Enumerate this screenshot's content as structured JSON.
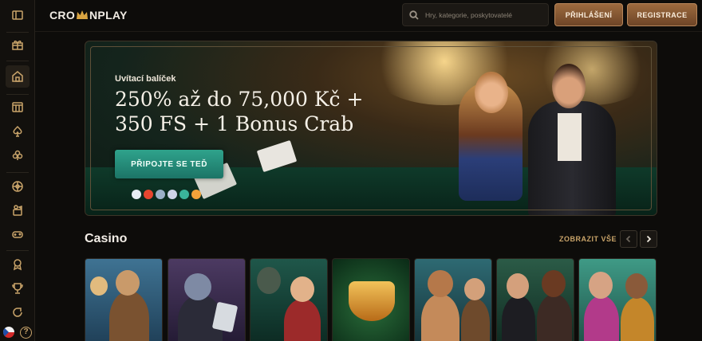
{
  "header": {
    "logo_text_left": "CRO",
    "logo_text_right": "NPLAY",
    "search_placeholder": "Hry, kategorie, poskytovatelé",
    "login_label": "PŘIHLÁŠENÍ",
    "register_label": "REGISTRACE"
  },
  "sidebar": {
    "icons": [
      "panel-toggle-icon",
      "gift-icon",
      "home-icon",
      "slot-machine-icon",
      "spade-icon",
      "clover-icon",
      "roulette-icon",
      "live-dealer-icon",
      "gamepad-icon",
      "medal-icon",
      "trophy-icon",
      "support-icon"
    ],
    "active": "home-icon",
    "language": "CZ"
  },
  "banner": {
    "subtitle": "Uvítací balíček",
    "headline_line1": "250% až do 75,000 Kč +",
    "headline_line2": "350 FS + 1 Bonus Crab",
    "cta_label": "PŘIPOJTE SE TEĎ",
    "payment_icons": [
      "visa-icon",
      "mastercard-icon",
      "bank-icon",
      "ethereum-icon",
      "tether-icon",
      "bitcoin-icon"
    ]
  },
  "casino": {
    "title": "Casino",
    "view_all_label": "ZOBRAZIT VŠE",
    "tiles": [
      {
        "name": "viking-slot-tile",
        "bg": "#2d5a7a"
      },
      {
        "name": "zombie-card-slot-tile",
        "bg": "#3b2a4d"
      },
      {
        "name": "circus-slot-tile",
        "bg": "#17443a"
      },
      {
        "name": "diamond-slot-tile",
        "bg": "#0f3b24"
      },
      {
        "name": "aztec-slot-tile",
        "bg": "#1d4f56"
      },
      {
        "name": "live-blackjack-tile",
        "bg": "#1b3d30"
      },
      {
        "name": "gambler-slot-tile",
        "bg": "#2f7a6a"
      }
    ]
  },
  "colors": {
    "accent_gold": "#c9a46a",
    "button_gold": "#9c6a3e",
    "cta_green": "#2fa38c",
    "background": "#0d0c0a"
  }
}
